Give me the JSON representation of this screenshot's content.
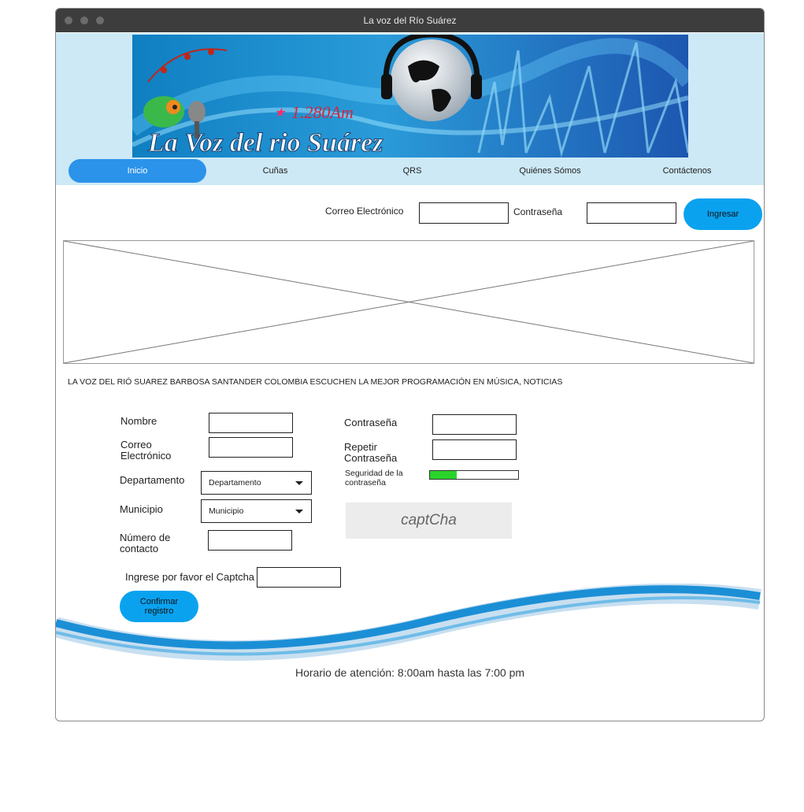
{
  "window": {
    "title": "La voz del Río Suárez"
  },
  "banner": {
    "frequency": "1.280Am",
    "station_name": "La Voz del rio Suárez"
  },
  "nav": {
    "items": [
      {
        "label": "Inicio",
        "active": true
      },
      {
        "label": "Cuñas"
      },
      {
        "label": "QRS"
      },
      {
        "label": "Quiénes Sómos"
      },
      {
        "label": "Contáctenos"
      }
    ]
  },
  "login": {
    "email_label": "Correo Electrónico",
    "password_label": "Contraseña",
    "submit_label": "Ingresar"
  },
  "slogan": "LA VOZ DEL RIÓ SUAREZ BARBOSA SANTANDER COLOMBIA ESCUCHEN LA MEJOR PROGRAMACIÓN EN MÚSICA, NOTICIAS",
  "register": {
    "name_label": "Nombre",
    "email_label": "Correo\nElectrónico",
    "department_label": "Departamento",
    "department_value": "Departamento",
    "municipality_label": "Municipio",
    "municipality_value": "Municipio",
    "phone_label": "Número de\ncontacto",
    "password_label": "Contraseña",
    "repeat_password_label": "Repetir\nContraseña",
    "strength_label": "Seguridad de la\ncontraseña",
    "strength_fraction": 0.3,
    "captcha_text": "captCha",
    "captcha_input_label": "Ingrese por favor el Captcha",
    "submit_label": "Confirmar registro"
  },
  "footer": {
    "hours": "Horario de atención: 8:00am hasta las 7:00 pm"
  },
  "colors": {
    "accent": "#0aa2ef",
    "nav_active": "#2b93ea",
    "header_bg": "#cde9f6",
    "strength": "#2ad32a"
  }
}
